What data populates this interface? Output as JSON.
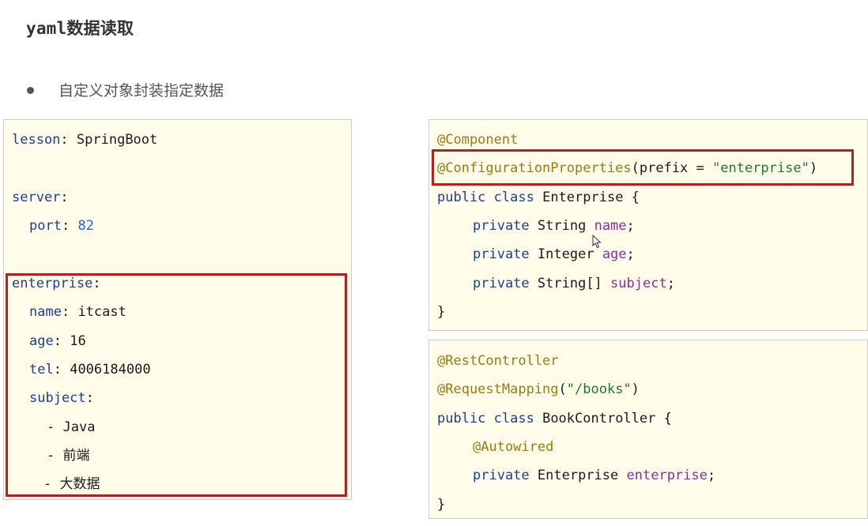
{
  "title": "yaml数据读取",
  "bullet": "自定义对象封装指定数据",
  "yaml": {
    "lesson_key": "lesson",
    "lesson_value": "SpringBoot",
    "server_key": "server",
    "port_key": "port",
    "port_value": "82",
    "enterprise_key": "enterprise",
    "name_key": "name",
    "name_value": "itcast",
    "age_key": "age",
    "age_value": "16",
    "tel_key": "tel",
    "tel_value": "4006184000",
    "subject_key": "subject",
    "subjects": [
      "Java",
      "前端",
      "大数据"
    ]
  },
  "enterprise_code": {
    "ann_component": "@Component",
    "ann_config": "@ConfigurationProperties",
    "prefix_open": "(prefix = ",
    "prefix_value": "\"enterprise\"",
    "prefix_close": ")",
    "kw_public_class": "public class",
    "class_name": "Enterprise {",
    "kw_private": "private",
    "type_string": "String",
    "field_name": "name",
    "type_integer": "Integer",
    "field_age": "age",
    "type_string_arr": "String[]",
    "field_subject": "subject",
    "semicolon": ";",
    "close_brace": "}"
  },
  "controller_code": {
    "ann_rest": "@RestController",
    "ann_mapping": "@RequestMapping",
    "mapping_open": "(",
    "mapping_value": "\"/books\"",
    "mapping_close": ")",
    "kw_public_class": "public class",
    "class_name": "BookController {",
    "ann_autowired": "@Autowired",
    "kw_private": "private",
    "type_enterprise": "Enterprise",
    "field_enterprise": "enterprise",
    "semicolon": ";",
    "close_brace": "}"
  },
  "colors": {
    "highlight_border": "#b22222",
    "code_background": "#fffdea"
  }
}
